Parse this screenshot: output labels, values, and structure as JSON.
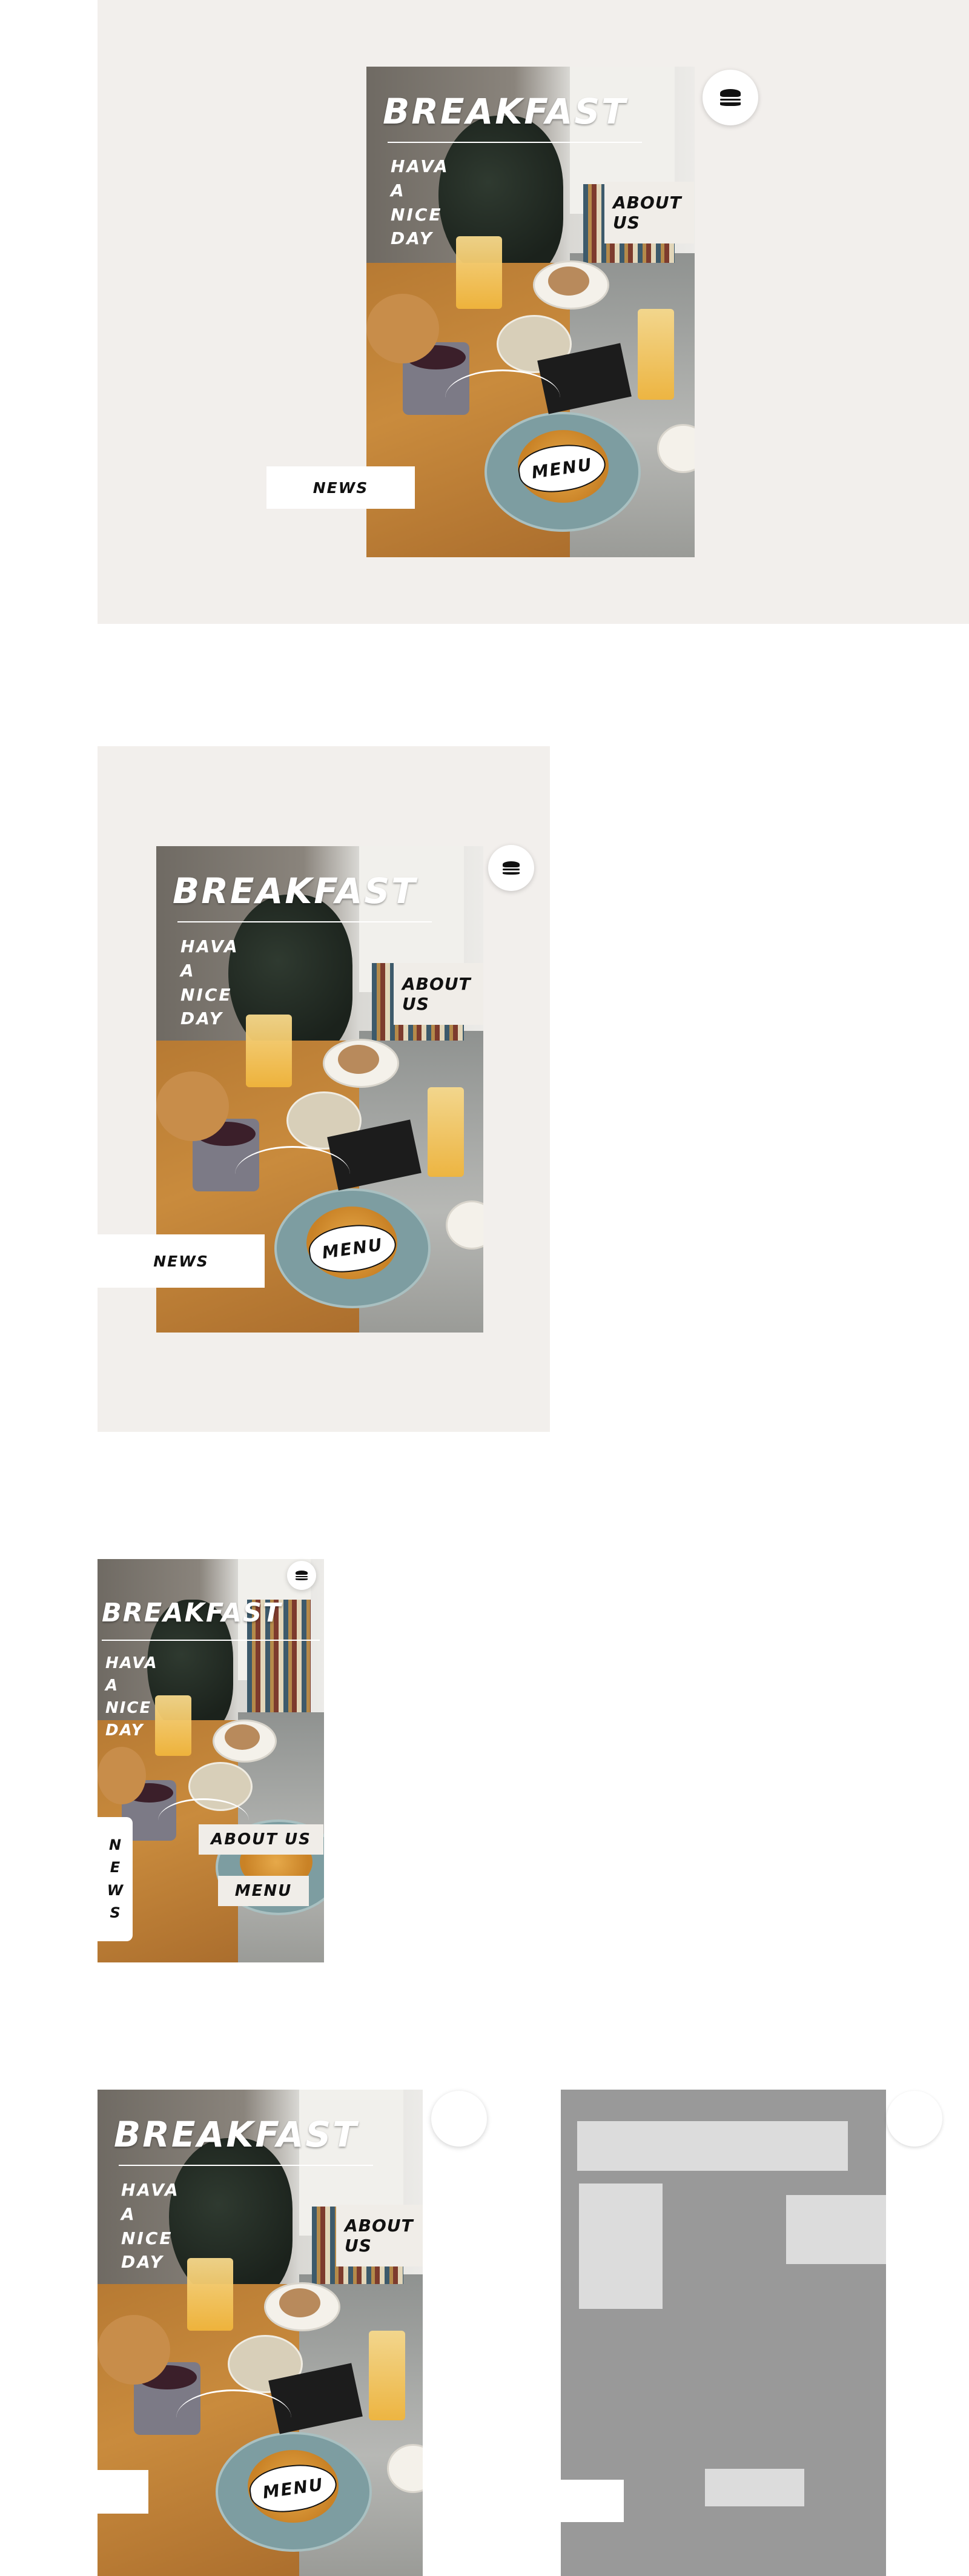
{
  "brand": {
    "title": "BREAKFAST",
    "tagline": [
      "HAVA",
      "A",
      "NICE",
      "DAY"
    ]
  },
  "nav": {
    "about_line1": "ABOUT",
    "about_line2": "US",
    "about_full": "ABOUT US",
    "menu": "MENU",
    "news": "NEWS",
    "news_letters": [
      "N",
      "E",
      "W",
      "S"
    ]
  },
  "icons": {
    "menu_toggle": "hamburger-menu-icon"
  },
  "colors": {
    "panel_background": "#f2efec",
    "page_background": "#ffffff",
    "wireframe_background": "#999999",
    "wireframe_block": "#dcdcdc",
    "label_background": "#f0ede8"
  }
}
